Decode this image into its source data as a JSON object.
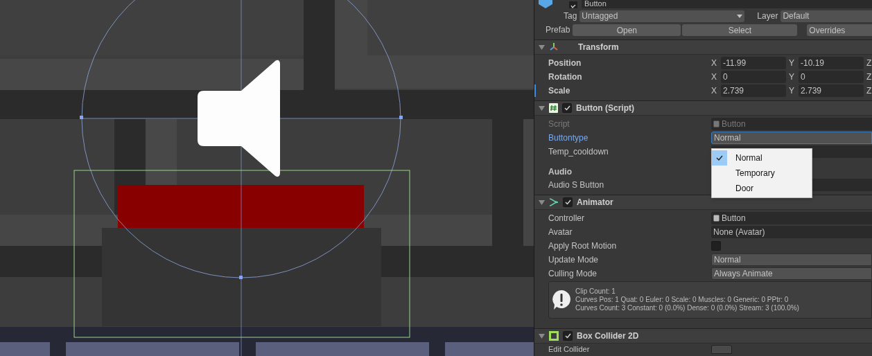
{
  "inspector": {
    "object": {
      "name": "Button",
      "active": true
    },
    "tag": {
      "label": "Tag",
      "value": "Untagged"
    },
    "layer": {
      "label": "Layer",
      "value": "Default"
    },
    "prefab": {
      "label": "Prefab",
      "buttons": [
        "Open",
        "Select",
        "Overrides"
      ]
    },
    "components": [
      {
        "kind": "transform",
        "title": "Transform",
        "expanded": true,
        "rows": [
          {
            "kind": "vector",
            "label": "Position",
            "selected": false,
            "fields": [
              {
                "axis": "X",
                "value": "-11.99"
              },
              {
                "axis": "Y",
                "value": "-10.19"
              },
              {
                "axis": "Z"
              }
            ]
          },
          {
            "kind": "vector",
            "label": "Rotation",
            "selected": false,
            "fields": [
              {
                "axis": "X",
                "value": "0"
              },
              {
                "axis": "Y",
                "value": "0"
              },
              {
                "axis": "Z"
              }
            ]
          },
          {
            "kind": "vector",
            "label": "Scale",
            "selected": true,
            "fields": [
              {
                "axis": "X",
                "value": "2.739"
              },
              {
                "axis": "Y",
                "value": "2.739"
              },
              {
                "axis": "Z"
              }
            ]
          }
        ]
      },
      {
        "kind": "script",
        "title": "Button (Script)",
        "expanded": true,
        "enabled": true,
        "rows": [
          {
            "kind": "object",
            "label": "Script",
            "value": "Button",
            "disabled": true
          },
          {
            "kind": "dropdown",
            "label": "Buttontype",
            "value": "Normal",
            "focused": true
          },
          {
            "kind": "field",
            "label": "Temp_cooldown"
          },
          {
            "kind": "heading",
            "label": "Audio"
          },
          {
            "kind": "field",
            "label": "Audio S Button"
          }
        ]
      },
      {
        "kind": "animator",
        "title": "Animator",
        "expanded": true,
        "enabled": true,
        "rows": [
          {
            "kind": "object",
            "label": "Controller",
            "value": "Button",
            "disabled": false
          },
          {
            "kind": "field",
            "label": "Avatar",
            "value": "None (Avatar)"
          },
          {
            "kind": "checkbox",
            "label": "Apply Root Motion",
            "checked": false
          },
          {
            "kind": "dropdown",
            "label": "Update Mode",
            "value": "Normal",
            "focused": false
          },
          {
            "kind": "dropdown",
            "label": "Culling Mode",
            "value": "Always Animate",
            "focused": false
          },
          {
            "kind": "info",
            "lines": [
              "Clip Count: 1",
              "Curves Pos: 1 Quat: 0 Euler: 0 Scale: 0 Muscles: 0 Generic: 0 PPtr: 0",
              "Curves Count: 3 Constant: 0 (0.0%) Dense: 0 (0.0%) Stream: 3 (100.0%)"
            ]
          }
        ]
      },
      {
        "kind": "collider",
        "title": "Box Collider 2D",
        "expanded": true,
        "enabled": true,
        "rows": [
          {
            "kind": "button",
            "label": "Edit Collider"
          }
        ]
      }
    ]
  },
  "dropdown_menu": {
    "options": [
      {
        "label": "Normal",
        "selected": true
      },
      {
        "label": "Temporary",
        "selected": false
      },
      {
        "label": "Door",
        "selected": false
      }
    ]
  }
}
